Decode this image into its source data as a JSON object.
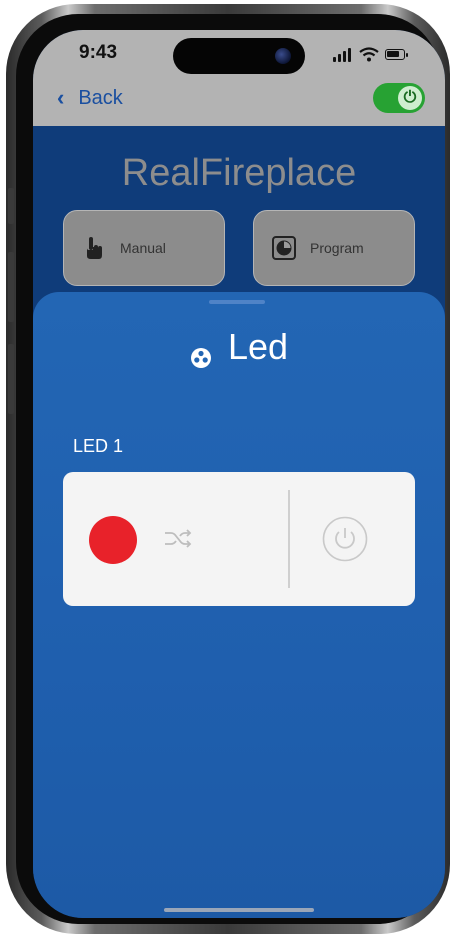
{
  "status_bar": {
    "time": "9:43"
  },
  "nav": {
    "back_label": "Back",
    "power_toggle_on": true
  },
  "header": {
    "title": "RealFireplace",
    "buttons": [
      {
        "label": "Manual",
        "icon": "hand-pointer-icon"
      },
      {
        "label": "Program",
        "icon": "clock-icon"
      }
    ]
  },
  "sheet": {
    "title": "Led",
    "title_icon": "led-bulb-icon",
    "leds": [
      {
        "label": "LED 1",
        "color": "#e8222a",
        "shuffle_icon": "shuffle-icon",
        "power_icon": "power-icon"
      }
    ]
  },
  "colors": {
    "header_bg": "#0f3c7a",
    "sheet_bg": "#2366b4",
    "toggle_on": "#27a233",
    "accent_text": "#1a4fa0"
  }
}
